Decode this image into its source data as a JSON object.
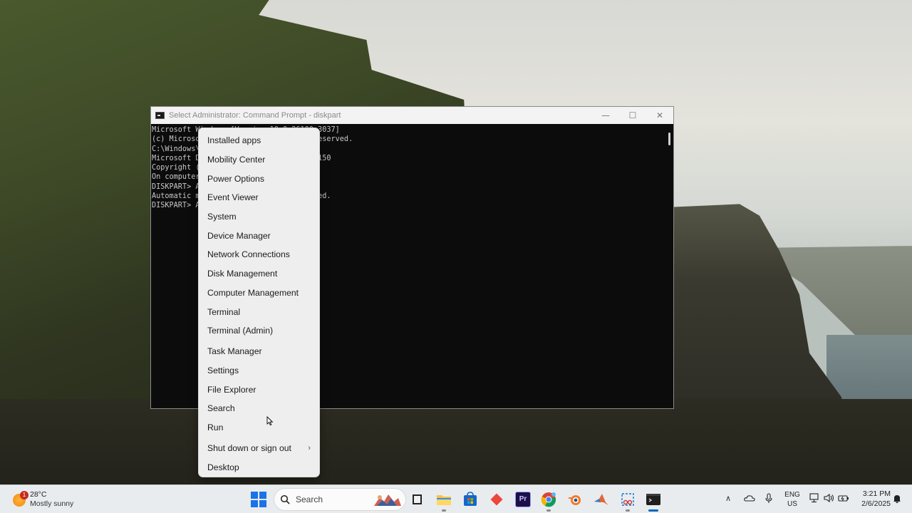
{
  "cmd_window": {
    "title": "Select Administrator: Command Prompt - diskpart",
    "minimize_glyph": "—",
    "maximize_glyph": "☐",
    "close_glyph": "✕",
    "console_lines": [
      "Microsoft Windows [Version 10.0.26100.3037]",
      "(c) Microso                           eserved.",
      "",
      "C:\\Windows\\",
      "",
      "Microsoft D                           150",
      "",
      "Copyright (",
      "On computer",
      "",
      "DISKPART> A",
      "",
      "Automatic m                           ed.",
      "",
      "DISKPART> A"
    ]
  },
  "context_menu": {
    "items": [
      "Installed apps",
      "Mobility Center",
      "Power Options",
      "Event Viewer",
      "System",
      "Device Manager",
      "Network Connections",
      "Disk Management",
      "Computer Management",
      "Terminal",
      "Terminal (Admin)",
      "Task Manager",
      "Settings",
      "File Explorer",
      "Search",
      "Run",
      "Shut down or sign out",
      "Desktop"
    ],
    "submenu_arrow": "›"
  },
  "taskbar": {
    "weather": {
      "badge": "1",
      "temperature": "28°C",
      "description": "Mostly sunny"
    },
    "search_label": "Search",
    "pinned_icons": [
      "task-view-icon",
      "file-explorer-icon",
      "microsoft-store-icon",
      "anydesk-icon",
      "premiere-pro-icon",
      "chrome-icon",
      "blender-icon",
      "matlab-icon",
      "snipping-tool-icon",
      "terminal-icon"
    ],
    "premiere_label": "Pr",
    "tray": {
      "chevron": "∧",
      "language": "ENG",
      "region": "US",
      "time": "3:21 PM",
      "date": "2/6/2025"
    }
  },
  "colors": {
    "taskbar_bg": "#e9ecef",
    "menu_bg": "#eeeeee",
    "console_bg": "#0c0c0c",
    "accent": "#0067c0"
  }
}
